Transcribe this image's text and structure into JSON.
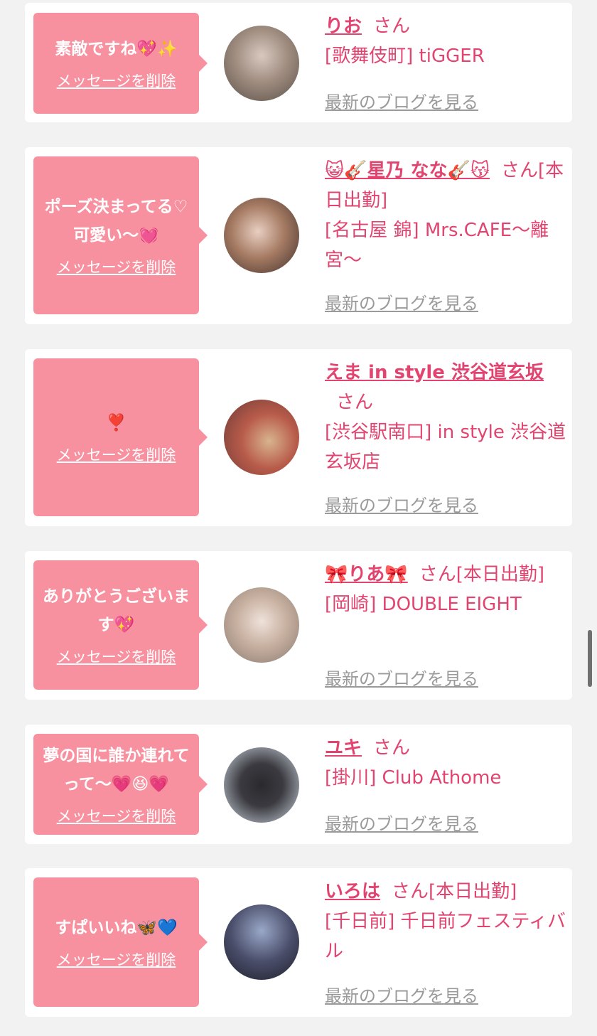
{
  "delete_label": "メッセージを削除",
  "blog_label": "最新のブログを見る",
  "san_suffix": "さん",
  "colors": {
    "bubble": "#f8919f",
    "accent": "#e2446f",
    "link_gray": "#9a9a9a",
    "background": "#f2f2f2"
  },
  "cards": [
    {
      "message": "素敵ですね💖✨",
      "name": "りお",
      "suffix": "さん",
      "shop": "[歌舞伎町] tiGGER"
    },
    {
      "message": "ポーズ決まってる♡可愛い〜💓",
      "name": "😺🎸星乃 なな🎸😽",
      "suffix": "さん[本日出勤]",
      "shop": "[名古屋 錦] Mrs.CAFE〜離宮〜"
    },
    {
      "message": "❣️",
      "name": "えま in style 渋谷道玄坂",
      "suffix": "さん",
      "shop": "[渋谷駅南口] in style 渋谷道玄坂店"
    },
    {
      "message": "ありがとうございます💖",
      "name": "🎀りあ🎀",
      "suffix": "さん[本日出勤]",
      "shop": "[岡崎] DOUBLE EIGHT"
    },
    {
      "message": "夢の国に誰か連れてって〜💗😆💗",
      "name": "ユキ",
      "suffix": "さん",
      "shop": "[掛川] Club Athome"
    },
    {
      "message": "すぱいいね🦋💙",
      "name": "いろは",
      "suffix": "さん[本日出勤]",
      "shop": "[千日前] 千日前フェスティバル"
    }
  ]
}
